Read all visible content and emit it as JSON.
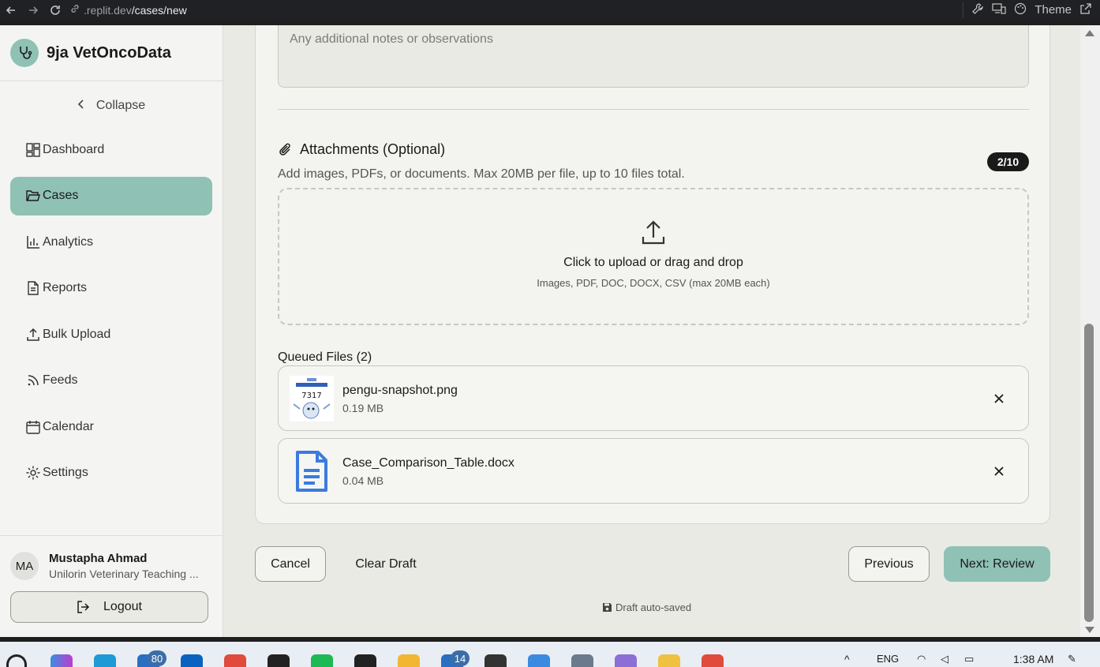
{
  "browser": {
    "url_domain": ".replit.dev",
    "url_path": "/cases/new",
    "theme_label": "Theme"
  },
  "sidebar": {
    "brand_name": "9ja VetOncoData",
    "collapse_label": "Collapse",
    "items": [
      {
        "label": "Dashboard",
        "icon": "dashboard-icon"
      },
      {
        "label": "Cases",
        "icon": "folder-icon",
        "active": true
      },
      {
        "label": "Analytics",
        "icon": "bar-chart-icon"
      },
      {
        "label": "Reports",
        "icon": "document-icon"
      },
      {
        "label": "Bulk Upload",
        "icon": "upload-icon"
      },
      {
        "label": "Feeds",
        "icon": "rss-icon"
      },
      {
        "label": "Calendar",
        "icon": "calendar-icon"
      },
      {
        "label": "Settings",
        "icon": "gear-icon"
      }
    ],
    "user": {
      "initials": "MA",
      "name": "Mustapha Ahmad",
      "org": "Unilorin Veterinary Teaching ..."
    },
    "logout_label": "Logout"
  },
  "form": {
    "notes_placeholder": "Any additional notes or observations",
    "attachments": {
      "title": "Attachments (Optional)",
      "subtitle": "Add images, PDFs, or documents. Max 20MB per file, up to 10 files total.",
      "count_badge": "2/10",
      "dropzone_title": "Click to upload or drag and drop",
      "dropzone_sub": "Images, PDF, DOC, DOCX, CSV (max 20MB each)",
      "queued_title": "Queued Files (2)",
      "files": [
        {
          "name": "pengu-snapshot.png",
          "size": "0.19 MB",
          "thumb_text": "7317"
        },
        {
          "name": "Case_Comparison_Table.docx",
          "size": "0.04 MB"
        }
      ]
    },
    "buttons": {
      "cancel": "Cancel",
      "clear_draft": "Clear Draft",
      "previous": "Previous",
      "next": "Next: Review"
    },
    "autosave": "Draft auto-saved"
  },
  "taskbar": {
    "mail_badge": "80",
    "app_badge": "14",
    "language": "ENG",
    "time": "1:38 AM"
  },
  "colors": {
    "accent": "#8fc1b5",
    "background": "#e9eae4",
    "card": "#f3f4ef",
    "docx_blue": "#3b7be0"
  }
}
